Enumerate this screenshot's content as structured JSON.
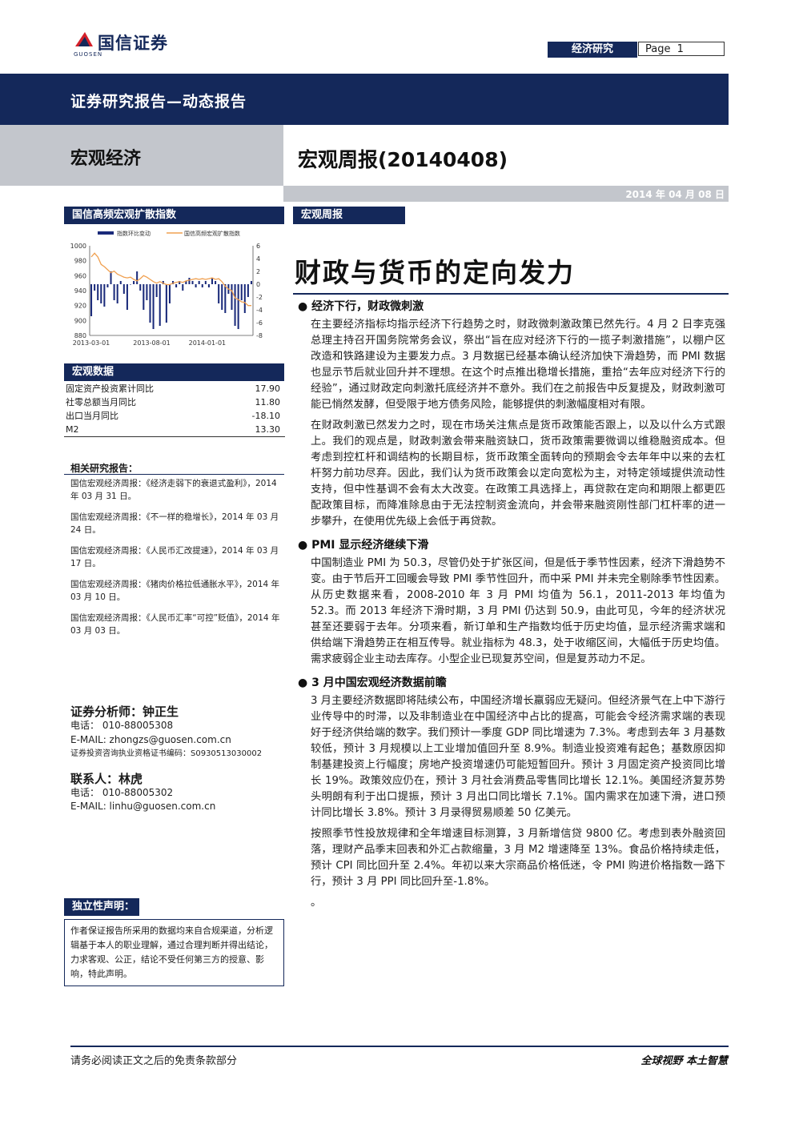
{
  "header": {
    "logo_text": "国信证券",
    "logo_sub": "GUOSEN",
    "tag": "经济研究",
    "page_label": "Page",
    "page_num": "1"
  },
  "band": {
    "title": "证券研究报告—动态报告"
  },
  "sub": {
    "left": "宏观经济",
    "right": "宏观周报(20140408)"
  },
  "date": "2014 年 04 月 08 日",
  "sidebar": {
    "chart_header": "国信高频宏观扩散指数",
    "macro_header": "宏观数据",
    "macro_rows": [
      {
        "label": "固定资产投资累计同比",
        "value": "17.90"
      },
      {
        "label": "社零总额当月同比",
        "value": "11.80"
      },
      {
        "label": "出口当月同比",
        "value": "-18.10"
      },
      {
        "label": "M2",
        "value": "13.30"
      }
    ],
    "related_header": "相关研究报告：",
    "related": [
      "国信宏观经济周报：《经济走弱下的衰退式盈利》，2014 年 03 月 31 日。",
      "国信宏观经济周报：《不一样的稳增长》，2014 年 03 月 24 日。",
      "国信宏观经济周报：《人民币汇改提速》，2014 年 03 月 17 日。",
      "国信宏观经济周报：《猪肉价格拉低通胀水平》，2014 年 03 月 10 日。",
      "国信宏观经济周报：《人民币汇率“可控”贬值》，2014 年 03 月 03 日。"
    ],
    "analyst_title": "证券分析师：钟正生",
    "analyst_tel": "电话：    010-88005308",
    "analyst_email": "E-MAIL:     zhongzs@guosen.com.cn",
    "analyst_cert": "证券投资咨询执业资格证书编码：S0930513030002",
    "contact_title": "联系人：林虎",
    "contact_tel": "电话：    010-88005302",
    "contact_email": "E-MAIL:     linhu@guosen.com.cn",
    "decl_header": "独立性声明：",
    "decl_text": "作者保证报告所采用的数据均来自合规渠道，分析逻辑基于本人的职业理解，通过合理判断并得出结论，力求客观、公正，结论不受任何第三方的授意、影响，特此声明。"
  },
  "chart_data": {
    "type": "bar+line",
    "legend": [
      "指数环比变动",
      "国信高频宏观扩散指数"
    ],
    "x_ticks": [
      "2013-03-01",
      "2013-08-01",
      "2014-01-01"
    ],
    "left_axis": {
      "ticks": [
        "1000",
        "980",
        "960",
        "940",
        "920",
        "900",
        "880"
      ],
      "ylim": [
        880,
        1000
      ]
    },
    "right_axis": {
      "ticks": [
        "6",
        "4",
        "2",
        "0",
        "-2",
        "-4",
        "-6",
        "-8"
      ],
      "ylim": [
        -8,
        6
      ]
    },
    "bar_values": [
      -5.0,
      -1.0,
      -2.5,
      -3.0,
      -3.5,
      -0.5,
      2.0,
      -2.5,
      -3.0,
      0.5,
      -1.5,
      -4.0,
      0.0,
      0.5,
      2.0,
      -1.0,
      -4.0,
      -2.5,
      -6.0,
      -7.0,
      -2.0,
      -6.5,
      0.5,
      -6.0,
      -3.0,
      0.5,
      -0.5,
      0.5,
      -1.0,
      0.5,
      1.0,
      0.5,
      -0.5,
      0.5,
      -0.5,
      0.5,
      -0.5,
      1.0,
      0.5,
      -3.0,
      -4.0,
      -4.5,
      -1.5,
      -4.0,
      -6.5,
      -7.0,
      -2.5,
      -4.5,
      -2.0,
      0.5
    ],
    "line_values": [
      985,
      990,
      985,
      975,
      972,
      968,
      964,
      966,
      962,
      960,
      958,
      957,
      958,
      955,
      953,
      956,
      960,
      958,
      955,
      952,
      950,
      952,
      950,
      948,
      948,
      950,
      951,
      952,
      951,
      953,
      954,
      955,
      956,
      955,
      956,
      955,
      956,
      957,
      955,
      956,
      952,
      946,
      942,
      940,
      930,
      928,
      925,
      924,
      920,
      920
    ]
  },
  "main": {
    "label": "宏观周报",
    "title": "财政与货币的定向发力",
    "sections": [
      {
        "heading": "经济下行，财政微刺激",
        "paras": [
          "在主要经济指标均指示经济下行趋势之时，财政微刺激政策已然先行。4 月 2 日李克强总理主持召开国务院常务会议，祭出“旨在应对经济下行的一揽子刺激措施”，以棚户区改造和铁路建设为主要发力点。3 月数据已经基本确认经济加快下滑趋势，而 PMI 数据也显示节后就业回升并不理想。在这个时点推出稳增长措施，重拾“去年应对经济下行的经验”，通过财政定向刺激托底经济并不意外。我们在之前报告中反复提及，财政刺激可能已悄然发酵，但受限于地方债务风险，能够提供的刺激幅度相对有限。",
          "在财政刺激已然发力之时，现在市场关注焦点是货币政策能否跟上，以及以什么方式跟上。我们的观点是，财政刺激会带来融资缺口，货币政策需要微调以维稳融资成本。但考虑到控杠杆和调结构的长期目标，货币政策全面转向的预期会令去年年中以来的去杠杆努力前功尽弃。因此，我们认为货币政策会以定向宽松为主，对特定领域提供流动性支持，但中性基调不会有太大改变。在政策工具选择上，再贷款在定向和期限上都更匹配政策目标，而降准除息由于无法控制资金流向，并会带来融资刚性部门杠杆率的进一步攀升，在使用优先级上会低于再贷款。"
        ]
      },
      {
        "heading": "PMI 显示经济继续下滑",
        "paras": [
          "中国制造业 PMI 为 50.3，尽管仍处于扩张区间，但是低于季节性因素，经济下滑趋势不变。由于节后开工回暖会导致 PMI 季节性回升，而中采 PMI 并未完全剔除季节性因素。从历史数据来看，2008-2010 年 3 月 PMI 均值为 56.1，2011-2013 年均值为 52.3。而 2013 年经济下滑时期，3 月 PMI 仍达到 50.9，由此可见，今年的经济状况甚至还要弱于去年。分项来看，新订单和生产指数均低于历史均值，显示经济需求端和供给端下滑趋势正在相互传导。就业指标为 48.3，处于收缩区间，大幅低于历史均值。需求疲弱企业主动去库存。小型企业已现复苏空间，但是复苏动力不足。"
        ]
      },
      {
        "heading": "3 月中国宏观经济数据前瞻",
        "paras": [
          "3 月主要经济数据即将陆续公布，中国经济增长羸弱应无疑问。但经济景气在上中下游行业传导中的时滞，以及非制造业在中国经济中占比的提高，可能会令经济需求端的表现好于经济供给端的数字。我们预计一季度 GDP 同比增速为 7.3%。考虑到去年 3 月基数较低，预计 3 月规模以上工业增加值回升至 8.9%。制造业投资难有起色；基数原因抑制基建投资上行幅度；房地产投资增速仍可能短暂回升。预计 3 月固定资产投资同比增长 19%。政策效应仍在，预计 3 月社会消费品零售同比增长 12.1%。美国经济复苏势头明朗有利于出口提振，预计 3 月出口同比增长 7.1%。国内需求在加速下滑，进口预计同比增长 3.8%。预计 3 月录得贸易顺差 50 亿美元。",
          "按照季节性投放规律和全年增速目标测算，3 月新增信贷 9800 亿。考虑到表外融资回落，理财产品季末回表和外汇占款缩量，3 月 M2 增速降至 13%。食品价格持续走低，预计 CPI 同比回升至 2.4%。年初以来大宗商品价格低迷，令 PMI 购进价格指数一路下行，预计 3 月 PPI 同比回升至-1.8%。",
          "。"
        ]
      }
    ]
  },
  "footer": {
    "left": "请务必阅读正文之后的免责条款部分",
    "right": "全球视野  本土智慧"
  },
  "colors": {
    "navy": "#14285a",
    "grey": "#c3c6cc",
    "bar": "#1a2a7a",
    "line": "#f0a050"
  }
}
